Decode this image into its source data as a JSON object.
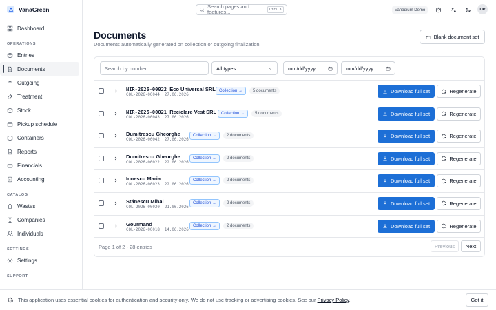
{
  "app": {
    "name": "VanaGreen",
    "tenant": "Vanadium Demo",
    "avatar": "OP"
  },
  "search": {
    "placeholder": "Search pages and features...",
    "shortcut": "Ctrl K"
  },
  "sidebar": {
    "top": [
      {
        "label": "Dashboard",
        "icon": "dashboard-icon"
      }
    ],
    "sections": [
      {
        "title": "OPERATIONS",
        "items": [
          {
            "label": "Entries",
            "icon": "entries-icon"
          },
          {
            "label": "Documents",
            "icon": "documents-icon",
            "active": true
          },
          {
            "label": "Outgoing",
            "icon": "outgoing-icon"
          },
          {
            "label": "Treatment",
            "icon": "treatment-icon"
          },
          {
            "label": "Stock",
            "icon": "stock-icon"
          },
          {
            "label": "Pickup schedule",
            "icon": "calendar-icon"
          },
          {
            "label": "Containers",
            "icon": "containers-icon"
          },
          {
            "label": "Reports",
            "icon": "reports-icon"
          },
          {
            "label": "Financials",
            "icon": "financials-icon"
          },
          {
            "label": "Accounting",
            "icon": "accounting-icon"
          }
        ]
      },
      {
        "title": "CATALOG",
        "items": [
          {
            "label": "Wastes",
            "icon": "wastes-icon"
          },
          {
            "label": "Companies",
            "icon": "companies-icon"
          },
          {
            "label": "Individuals",
            "icon": "individuals-icon"
          }
        ]
      },
      {
        "title": "SETTINGS",
        "items": [
          {
            "label": "Settings",
            "icon": "settings-icon"
          }
        ]
      },
      {
        "title": "SUPPORT",
        "items": []
      }
    ]
  },
  "page": {
    "title": "Documents",
    "subtitle": "Documents automatically generated on collection or outgoing finalization.",
    "blank_button": "Blank document set"
  },
  "filters": {
    "search_placeholder": "Search by number...",
    "type_selected": "All types",
    "date_from": "mm/dd/yyyy",
    "date_to": "mm/dd/yyyy"
  },
  "rows": [
    {
      "code": "NIR-2026-00022",
      "name": "Eco Universal SRL",
      "ref": "COL-2026-00044",
      "date": "27.06.2026",
      "tag": "Collection →",
      "count": "5 documents"
    },
    {
      "code": "NIR-2026-00021",
      "name": "Reciclare Vest SRL",
      "ref": "COL-2026-00043",
      "date": "27.06.2026",
      "tag": "Collection →",
      "count": "5 documents"
    },
    {
      "code": "",
      "name": "Dumitrescu Gheorghe",
      "ref": "COL-2026-00042",
      "date": "27.06.2026",
      "tag": "Collection →",
      "count": "2 documents"
    },
    {
      "code": "",
      "name": "Dumitrescu Gheorghe",
      "ref": "COL-2026-00022",
      "date": "22.06.2026",
      "tag": "Collection →",
      "count": "2 documents"
    },
    {
      "code": "",
      "name": "Ionescu Maria",
      "ref": "COL-2026-00023",
      "date": "22.06.2026",
      "tag": "Collection →",
      "count": "2 documents"
    },
    {
      "code": "",
      "name": "Stănescu Mihai",
      "ref": "COL-2026-00020",
      "date": "21.06.2026",
      "tag": "Collection →",
      "count": "2 documents"
    },
    {
      "code": "",
      "name": "Gourmand",
      "ref": "COL-2026-00018",
      "date": "14.06.2026",
      "tag": "Collection →",
      "count": "2 documents"
    }
  ],
  "row_actions": {
    "download": "Download full set",
    "regenerate": "Regenerate"
  },
  "pagination": {
    "summary": "Page 1 of 2 · 28 entries",
    "previous": "Previous",
    "next": "Next"
  },
  "cookie": {
    "text": "This application uses essential cookies for authentication and security only. We do not use tracking or advertising cookies. See our ",
    "link": "Privacy Policy",
    "end": ".",
    "button": "Got it"
  },
  "colors": {
    "primary": "#1d6fd6",
    "tag_blue": "#1d4ed8"
  }
}
